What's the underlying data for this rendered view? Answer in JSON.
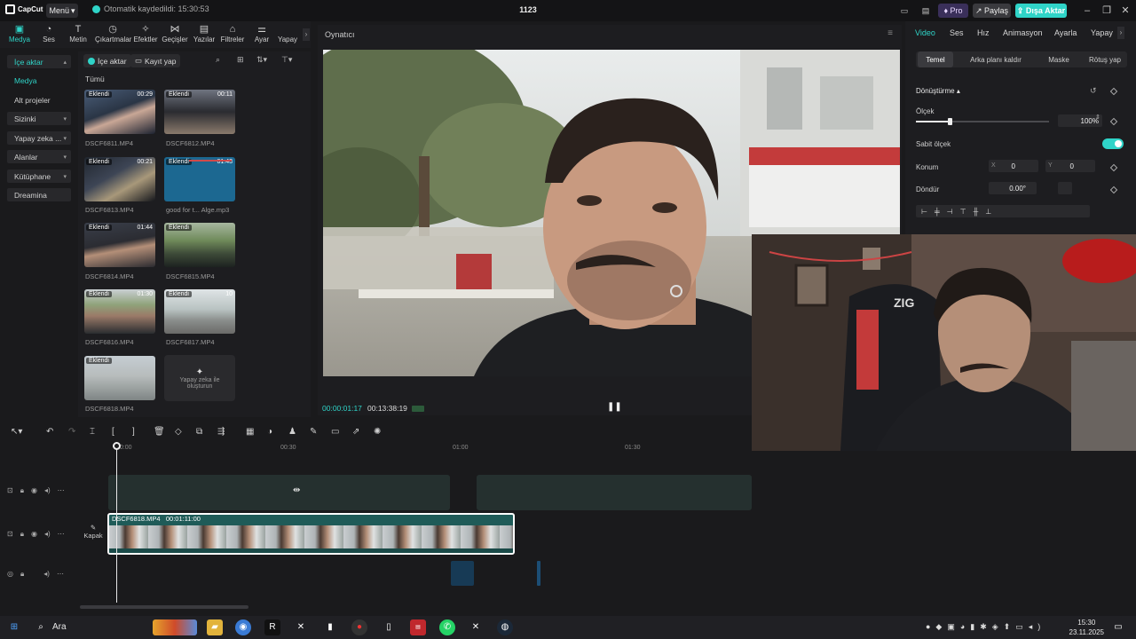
{
  "app": {
    "logo_text": "CapCut",
    "menu_label": "Menü",
    "autosave_text": "Otomatik kaydedildi: 15:30:53",
    "project_title": "1123",
    "pro_label": "Pro",
    "share_label": "Paylaş",
    "export_label": "Dışa Aktar",
    "accent_color": "#2fd4c8"
  },
  "toolbar": {
    "tabs": [
      {
        "label": "Medya",
        "icon": "media-icon"
      },
      {
        "label": "Ses",
        "icon": "audio-icon"
      },
      {
        "label": "Metin",
        "icon": "text-icon"
      },
      {
        "label": "Çıkartmalar",
        "icon": "sticker-icon"
      },
      {
        "label": "Efektler",
        "icon": "effects-icon"
      },
      {
        "label": "Geçişler",
        "icon": "transitions-icon"
      },
      {
        "label": "Yazılar",
        "icon": "captions-icon"
      },
      {
        "label": "Filtreler",
        "icon": "filters-icon"
      },
      {
        "label": "Ayar",
        "icon": "adjust-icon"
      },
      {
        "label": "Yapay",
        "icon": "ai-icon"
      }
    ]
  },
  "sidenav": {
    "items": [
      {
        "label": "İçe aktar"
      },
      {
        "label": "Medya"
      },
      {
        "label": "Alt projeler"
      },
      {
        "label": "Sizinki"
      },
      {
        "label": "Yapay zeka ..."
      },
      {
        "label": "Alanlar"
      },
      {
        "label": "Kütüphane"
      },
      {
        "label": "Dreamina"
      }
    ]
  },
  "media": {
    "import_label": "İçe aktar",
    "record_label": "Kayıt yap",
    "filter_label": "Tümü",
    "added_badge": "Eklendi",
    "items": [
      {
        "name": "DSCF6811.MP4",
        "duration": "00:29"
      },
      {
        "name": "DSCF6812.MP4",
        "duration": "00:11"
      },
      {
        "name": "DSCF6813.MP4",
        "duration": "00:21"
      },
      {
        "name": "good for t... Alge.mp3",
        "duration": "01:43"
      },
      {
        "name": "DSCF6814.MP4",
        "duration": "01:44"
      },
      {
        "name": "DSCF6815.MP4",
        "duration": ""
      },
      {
        "name": "DSCF6816.MP4",
        "duration": "01:30"
      },
      {
        "name": "DSCF6817.MP4",
        "duration": "10"
      },
      {
        "name": "DSCF6818.MP4",
        "duration": ""
      }
    ],
    "ai_card_line1": "Yapay zeka ile",
    "ai_card_line2": "oluşturun"
  },
  "player": {
    "title": "Oynatıcı",
    "current_time": "00:00:01:17",
    "total_time": "00:13:38:19"
  },
  "inspector": {
    "tabs": [
      "Video",
      "Ses",
      "Hız",
      "Animasyon",
      "Ayarla",
      "Yapay"
    ],
    "subtabs": [
      "Temel",
      "Arka planı kaldır",
      "Maske",
      "Rötuş yap"
    ],
    "transform_label": "Dönüştürme",
    "scale_label": "Ölçek",
    "scale_value": "100%",
    "uniform_scale_label": "Sabit ölçek",
    "position_label": "Konum",
    "pos_x_label": "X",
    "pos_x": "0",
    "pos_y_label": "Y",
    "pos_y": "0",
    "rotate_label": "Döndür",
    "rotate_value": "0.00°",
    "scale_fraction": 0.25
  },
  "timeline": {
    "ruler_ticks": [
      "00:00",
      "00:30",
      "01:00",
      "01:30"
    ],
    "main_clip_name": "DSCF6818.MP4",
    "main_clip_duration": "00:01:11:00",
    "cover_label": "Kapak"
  },
  "taskbar": {
    "search_label": "Ara",
    "time": "15:30",
    "date": "23.11.2025"
  }
}
